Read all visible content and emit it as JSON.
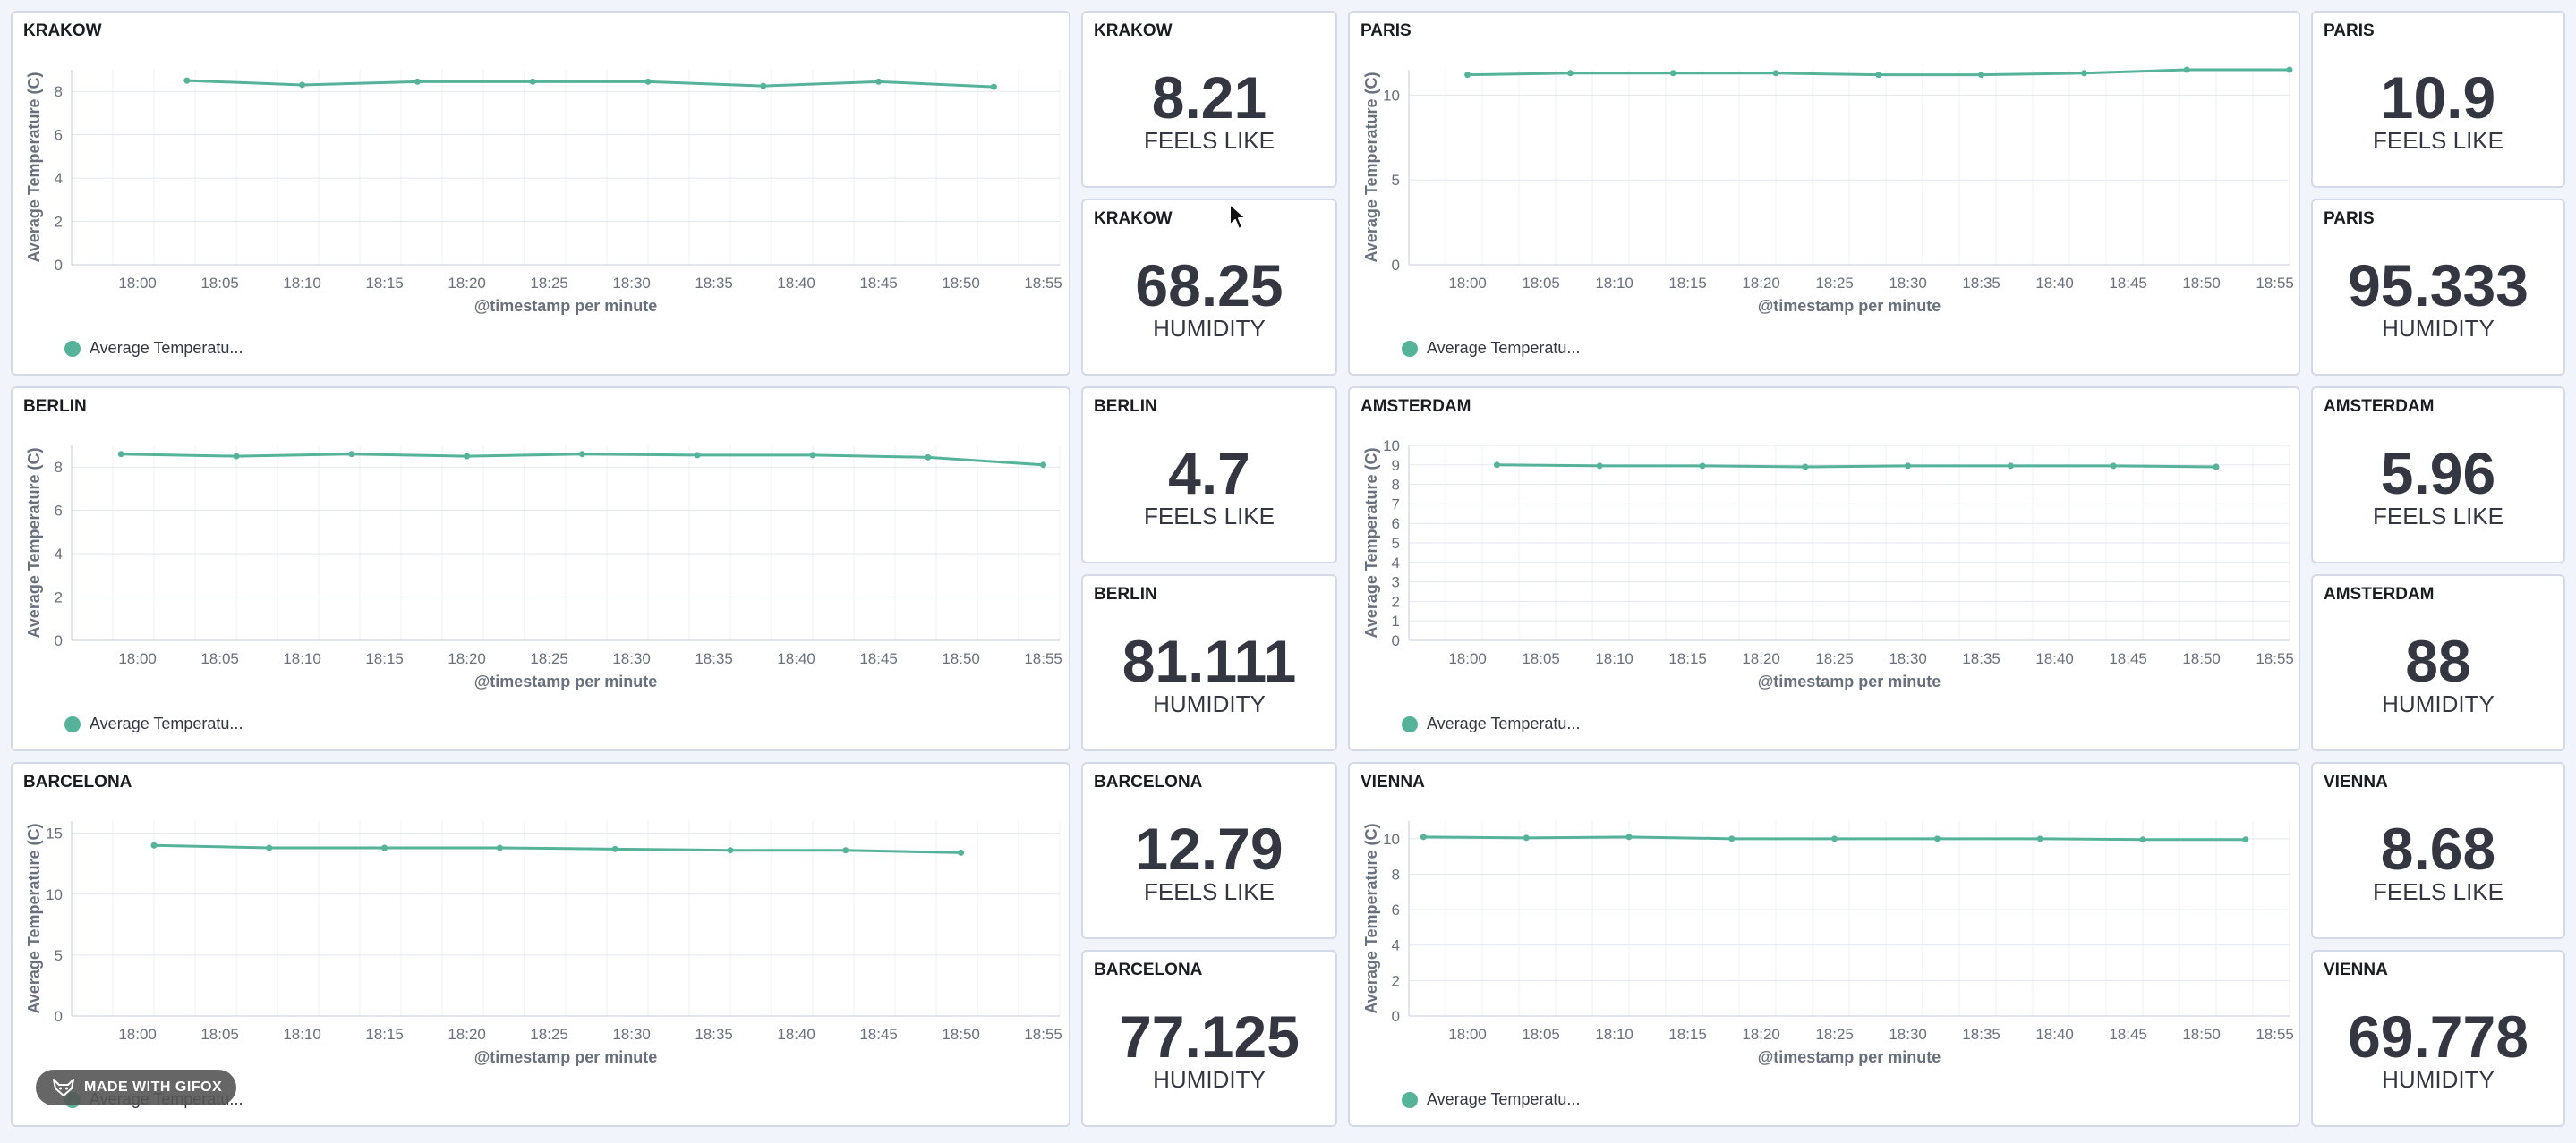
{
  "accent_color": "#54b399",
  "chart_panels": [
    {
      "id": "krakow-chart",
      "title": "KRAKOW",
      "y_axis_title": "Average Temperature (C)",
      "x_axis_title": "@timestamp per minute",
      "legend_label": "Average Temperatu...",
      "y_ticks": [
        "0",
        "2",
        "4",
        "6",
        "8"
      ],
      "x_ticks": [
        "18:00",
        "18:05",
        "18:10",
        "18:15",
        "18:20",
        "18:25",
        "18:30",
        "18:35",
        "18:40",
        "18:45",
        "18:50",
        "18:55"
      ],
      "chart_data": {
        "type": "line",
        "ylim": [
          0,
          9
        ],
        "ylabel": "Average Temperature (C)",
        "xlabel": "@timestamp per minute",
        "series": [
          {
            "name": "Average Temperatu...",
            "points": [
              {
                "x": "18:03",
                "y": 8.5
              },
              {
                "x": "18:10",
                "y": 8.3
              },
              {
                "x": "18:17",
                "y": 8.45
              },
              {
                "x": "18:24",
                "y": 8.45
              },
              {
                "x": "18:31",
                "y": 8.45
              },
              {
                "x": "18:38",
                "y": 8.25
              },
              {
                "x": "18:45",
                "y": 8.45
              },
              {
                "x": "18:52",
                "y": 8.21
              }
            ]
          }
        ]
      }
    },
    {
      "id": "paris-chart",
      "title": "PARIS",
      "y_axis_title": "Average Temperature (C)",
      "x_axis_title": "@timestamp per minute",
      "legend_label": "Average Temperatu...",
      "y_ticks": [
        "0",
        "5",
        "10"
      ],
      "x_ticks": [
        "18:00",
        "18:05",
        "18:10",
        "18:15",
        "18:20",
        "18:25",
        "18:30",
        "18:35",
        "18:40",
        "18:45",
        "18:50",
        "18:55"
      ],
      "chart_data": {
        "type": "line",
        "ylim": [
          0,
          11.5
        ],
        "ylabel": "Average Temperature (C)",
        "xlabel": "@timestamp per minute",
        "series": [
          {
            "name": "Average Temperatu...",
            "points": [
              {
                "x": "18:00",
                "y": 11.2
              },
              {
                "x": "18:07",
                "y": 11.3
              },
              {
                "x": "18:14",
                "y": 11.3
              },
              {
                "x": "18:21",
                "y": 11.3
              },
              {
                "x": "18:28",
                "y": 11.2
              },
              {
                "x": "18:35",
                "y": 11.2
              },
              {
                "x": "18:42",
                "y": 11.3
              },
              {
                "x": "18:49",
                "y": 11.5
              },
              {
                "x": "18:56",
                "y": 11.5
              }
            ]
          }
        ]
      }
    },
    {
      "id": "berlin-chart",
      "title": "BERLIN",
      "y_axis_title": "Average Temperature (C)",
      "x_axis_title": "@timestamp per minute",
      "legend_label": "Average Temperatu...",
      "y_ticks": [
        "0",
        "2",
        "4",
        "6",
        "8"
      ],
      "x_ticks": [
        "18:00",
        "18:05",
        "18:10",
        "18:15",
        "18:20",
        "18:25",
        "18:30",
        "18:35",
        "18:40",
        "18:45",
        "18:50",
        "18:55"
      ],
      "chart_data": {
        "type": "line",
        "ylim": [
          0,
          9
        ],
        "ylabel": "Average Temperature (C)",
        "xlabel": "@timestamp per minute",
        "series": [
          {
            "name": "Average Temperatu...",
            "points": [
              {
                "x": "17:59",
                "y": 8.6
              },
              {
                "x": "18:06",
                "y": 8.5
              },
              {
                "x": "18:13",
                "y": 8.6
              },
              {
                "x": "18:20",
                "y": 8.5
              },
              {
                "x": "18:27",
                "y": 8.6
              },
              {
                "x": "18:34",
                "y": 8.55
              },
              {
                "x": "18:41",
                "y": 8.55
              },
              {
                "x": "18:48",
                "y": 8.45
              },
              {
                "x": "18:55",
                "y": 8.1
              }
            ]
          }
        ]
      }
    },
    {
      "id": "amsterdam-chart",
      "title": "AMSTERDAM",
      "y_axis_title": "Average Temperature (C)",
      "x_axis_title": "@timestamp per minute",
      "legend_label": "Average Temperatu...",
      "y_ticks": [
        "0",
        "1",
        "2",
        "3",
        "4",
        "5",
        "6",
        "7",
        "8",
        "9",
        "10"
      ],
      "x_ticks": [
        "18:00",
        "18:05",
        "18:10",
        "18:15",
        "18:20",
        "18:25",
        "18:30",
        "18:35",
        "18:40",
        "18:45",
        "18:50",
        "18:55"
      ],
      "chart_data": {
        "type": "line",
        "ylim": [
          0,
          10
        ],
        "ylabel": "Average Temperature (C)",
        "xlabel": "@timestamp per minute",
        "series": [
          {
            "name": "Average Temperatu...",
            "points": [
              {
                "x": "18:02",
                "y": 9.0
              },
              {
                "x": "18:09",
                "y": 8.95
              },
              {
                "x": "18:16",
                "y": 8.95
              },
              {
                "x": "18:23",
                "y": 8.9
              },
              {
                "x": "18:30",
                "y": 8.95
              },
              {
                "x": "18:37",
                "y": 8.95
              },
              {
                "x": "18:44",
                "y": 8.95
              },
              {
                "x": "18:51",
                "y": 8.9
              }
            ]
          }
        ]
      }
    },
    {
      "id": "barcelona-chart",
      "title": "BARCELONA",
      "y_axis_title": "Average Temperature (C)",
      "x_axis_title": "@timestamp per minute",
      "legend_label": "Average Temperatu...",
      "y_ticks": [
        "0",
        "5",
        "10",
        "15"
      ],
      "x_ticks": [
        "18:00",
        "18:05",
        "18:10",
        "18:15",
        "18:20",
        "18:25",
        "18:30",
        "18:35",
        "18:40",
        "18:45",
        "18:50",
        "18:55"
      ],
      "chart_data": {
        "type": "line",
        "ylim": [
          0,
          16
        ],
        "ylabel": "Average Temperature (C)",
        "xlabel": "@timestamp per minute",
        "series": [
          {
            "name": "Average Temperatu...",
            "points": [
              {
                "x": "18:01",
                "y": 14.0
              },
              {
                "x": "18:08",
                "y": 13.8
              },
              {
                "x": "18:15",
                "y": 13.8
              },
              {
                "x": "18:22",
                "y": 13.8
              },
              {
                "x": "18:29",
                "y": 13.7
              },
              {
                "x": "18:36",
                "y": 13.6
              },
              {
                "x": "18:43",
                "y": 13.6
              },
              {
                "x": "18:50",
                "y": 13.4
              }
            ]
          }
        ]
      }
    },
    {
      "id": "vienna-chart",
      "title": "VIENNA",
      "y_axis_title": "Average Temperature (C)",
      "x_axis_title": "@timestamp per minute",
      "legend_label": "Average Temperatu...",
      "y_ticks": [
        "0",
        "2",
        "4",
        "6",
        "8",
        "10"
      ],
      "x_ticks": [
        "18:00",
        "18:05",
        "18:10",
        "18:15",
        "18:20",
        "18:25",
        "18:30",
        "18:35",
        "18:40",
        "18:45",
        "18:50",
        "18:55"
      ],
      "chart_data": {
        "type": "line",
        "ylim": [
          0,
          11
        ],
        "ylabel": "Average Temperature (C)",
        "xlabel": "@timestamp per minute",
        "series": [
          {
            "name": "Average Temperatu...",
            "points": [
              {
                "x": "17:57",
                "y": 10.1
              },
              {
                "x": "18:04",
                "y": 10.05
              },
              {
                "x": "18:11",
                "y": 10.1
              },
              {
                "x": "18:18",
                "y": 10.0
              },
              {
                "x": "18:25",
                "y": 10.0
              },
              {
                "x": "18:32",
                "y": 10.0
              },
              {
                "x": "18:39",
                "y": 10.0
              },
              {
                "x": "18:46",
                "y": 9.95
              },
              {
                "x": "18:53",
                "y": 9.95
              }
            ]
          }
        ]
      }
    }
  ],
  "metric_panels": [
    {
      "id": "krakow-feels",
      "title": "KRAKOW",
      "value": "8.21",
      "label": "FEELS LIKE"
    },
    {
      "id": "krakow-humidity",
      "title": "KRAKOW",
      "value": "68.25",
      "label": "HUMIDITY"
    },
    {
      "id": "paris-feels",
      "title": "PARIS",
      "value": "10.9",
      "label": "FEELS LIKE"
    },
    {
      "id": "paris-humidity",
      "title": "PARIS",
      "value": "95.333",
      "label": "HUMIDITY"
    },
    {
      "id": "berlin-feels",
      "title": "BERLIN",
      "value": "4.7",
      "label": "FEELS LIKE"
    },
    {
      "id": "berlin-humidity",
      "title": "BERLIN",
      "value": "81.111",
      "label": "HUMIDITY"
    },
    {
      "id": "amsterdam-feels",
      "title": "AMSTERDAM",
      "value": "5.96",
      "label": "FEELS LIKE"
    },
    {
      "id": "amsterdam-humidity",
      "title": "AMSTERDAM",
      "value": "88",
      "label": "HUMIDITY"
    },
    {
      "id": "barcelona-feels",
      "title": "BARCELONA",
      "value": "12.79",
      "label": "FEELS LIKE"
    },
    {
      "id": "barcelona-humidity",
      "title": "BARCELONA",
      "value": "77.125",
      "label": "HUMIDITY"
    },
    {
      "id": "vienna-feels",
      "title": "VIENNA",
      "value": "8.68",
      "label": "FEELS LIKE"
    },
    {
      "id": "vienna-humidity",
      "title": "VIENNA",
      "value": "69.778",
      "label": "HUMIDITY"
    }
  ],
  "badge": {
    "text": "MADE WITH GIFOX",
    "icon": "fox-icon"
  }
}
